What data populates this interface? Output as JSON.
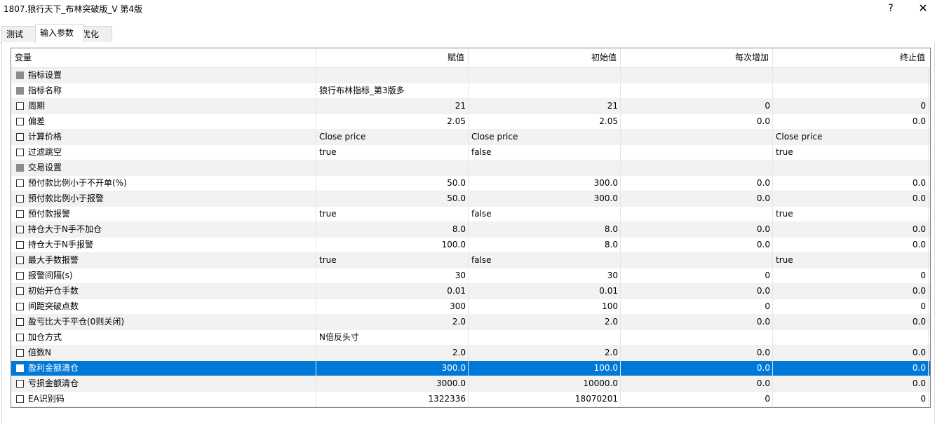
{
  "window": {
    "title": "1807.狼行天下_布林突破版_V 第4版",
    "help_label": "?",
    "close_label": "✕"
  },
  "tabs": [
    {
      "label": "测试"
    },
    {
      "label": "输入参数"
    },
    {
      "label": "优化"
    }
  ],
  "columns": [
    "变量",
    "赋值",
    "初始值",
    "每次增加",
    "终止值"
  ],
  "rows": [
    {
      "name": "指标设置",
      "value": "",
      "start": "",
      "step": "",
      "stop": "",
      "group": true
    },
    {
      "name": "指标名称",
      "value": "狼行布林指标_第3版多",
      "start": "",
      "step": "",
      "stop": "",
      "group": true,
      "text": true
    },
    {
      "name": "周期",
      "value": "21",
      "start": "21",
      "step": "0",
      "stop": "0"
    },
    {
      "name": "偏差",
      "value": "2.05",
      "start": "2.05",
      "step": "0.0",
      "stop": "0.0"
    },
    {
      "name": "计算价格",
      "value": "Close price",
      "start": "Close price",
      "step": "",
      "stop": "Close price",
      "text": true
    },
    {
      "name": "过滤跳空",
      "value": "true",
      "start": "false",
      "step": "",
      "stop": "true",
      "text": true
    },
    {
      "name": "交易设置",
      "value": "",
      "start": "",
      "step": "",
      "stop": "",
      "group": true
    },
    {
      "name": "预付款比例小于不开单(%)",
      "value": "50.0",
      "start": "300.0",
      "step": "0.0",
      "stop": "0.0"
    },
    {
      "name": "预付款比例小于报警",
      "value": "50.0",
      "start": "300.0",
      "step": "0.0",
      "stop": "0.0"
    },
    {
      "name": "预付款报警",
      "value": "true",
      "start": "false",
      "step": "",
      "stop": "true",
      "text": true
    },
    {
      "name": "持仓大于N手不加仓",
      "value": "8.0",
      "start": "8.0",
      "step": "0.0",
      "stop": "0.0"
    },
    {
      "name": "持仓大于N手报警",
      "value": "100.0",
      "start": "8.0",
      "step": "0.0",
      "stop": "0.0"
    },
    {
      "name": "最大手数报警",
      "value": "true",
      "start": "false",
      "step": "",
      "stop": "true",
      "text": true
    },
    {
      "name": "报警间隔(s)",
      "value": "30",
      "start": "30",
      "step": "0",
      "stop": "0"
    },
    {
      "name": "初始开仓手数",
      "value": "0.01",
      "start": "0.01",
      "step": "0.0",
      "stop": "0.0"
    },
    {
      "name": "间距突破点数",
      "value": "300",
      "start": "100",
      "step": "0",
      "stop": "0"
    },
    {
      "name": "盈亏比大于平仓(0则关闭)",
      "value": "2.0",
      "start": "2.0",
      "step": "0.0",
      "stop": "0.0"
    },
    {
      "name": "加仓方式",
      "value": "N倍反头寸",
      "start": "",
      "step": "",
      "stop": "",
      "text": true
    },
    {
      "name": "倍数N",
      "value": "2.0",
      "start": "2.0",
      "step": "0.0",
      "stop": "0.0"
    },
    {
      "name": "盈利金额清仓",
      "value": "300.0",
      "start": "100.0",
      "step": "0.0",
      "stop": "0.0",
      "selected": true
    },
    {
      "name": "亏损金额清仓",
      "value": "3000.0",
      "start": "10000.0",
      "step": "0.0",
      "stop": "0.0"
    },
    {
      "name": "EA识别码",
      "value": "1322336",
      "start": "18070201",
      "step": "0",
      "stop": "0"
    }
  ],
  "colors": {
    "selection": "#0078d7",
    "alt_row": "#f2f2f2"
  }
}
